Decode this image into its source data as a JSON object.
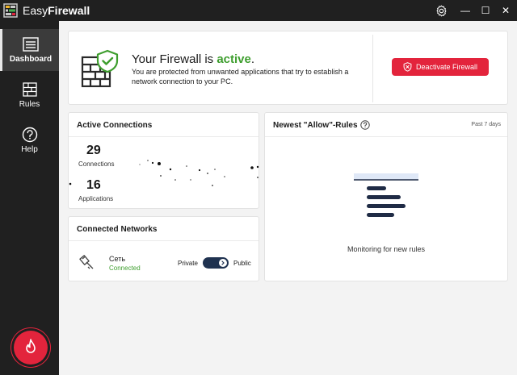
{
  "window": {
    "title_part1": "Easy",
    "title_part2": "Firewall",
    "settings_icon": "gear-icon",
    "minimize_symbol": "—",
    "maximize_symbol": "☐",
    "close_symbol": "✕"
  },
  "sidebar": {
    "items": [
      {
        "label": "Dashboard",
        "icon": "dashboard-icon",
        "active": true
      },
      {
        "label": "Rules",
        "icon": "rules-icon",
        "active": false
      },
      {
        "label": "Help",
        "icon": "help-icon",
        "active": false
      }
    ],
    "firewall_button_icon": "flame-icon"
  },
  "status": {
    "title_prefix": "Your Firewall is ",
    "title_state": "active",
    "title_suffix": ".",
    "description": "You are protected from unwanted applications that try to establish a network connection to your PC.",
    "deactivate_label": "Deactivate Firewall"
  },
  "connections": {
    "title": "Active Connections",
    "connections_count": "29",
    "connections_label": "Connections",
    "applications_count": "16",
    "applications_label": "Applications"
  },
  "networks": {
    "title": "Connected Networks",
    "name": "Сеть",
    "status": "Connected",
    "private_label": "Private",
    "public_label": "Public",
    "toggle_public": true
  },
  "rules": {
    "title": "Newest \"Allow\"-Rules",
    "period": "Past 7 days",
    "empty_text": "Monitoring for new rules"
  },
  "colors": {
    "accent_red": "#e3243c",
    "active_green": "#3e9e2e",
    "toggle_navy": "#1f3250",
    "sidebar_bg": "#202020"
  }
}
